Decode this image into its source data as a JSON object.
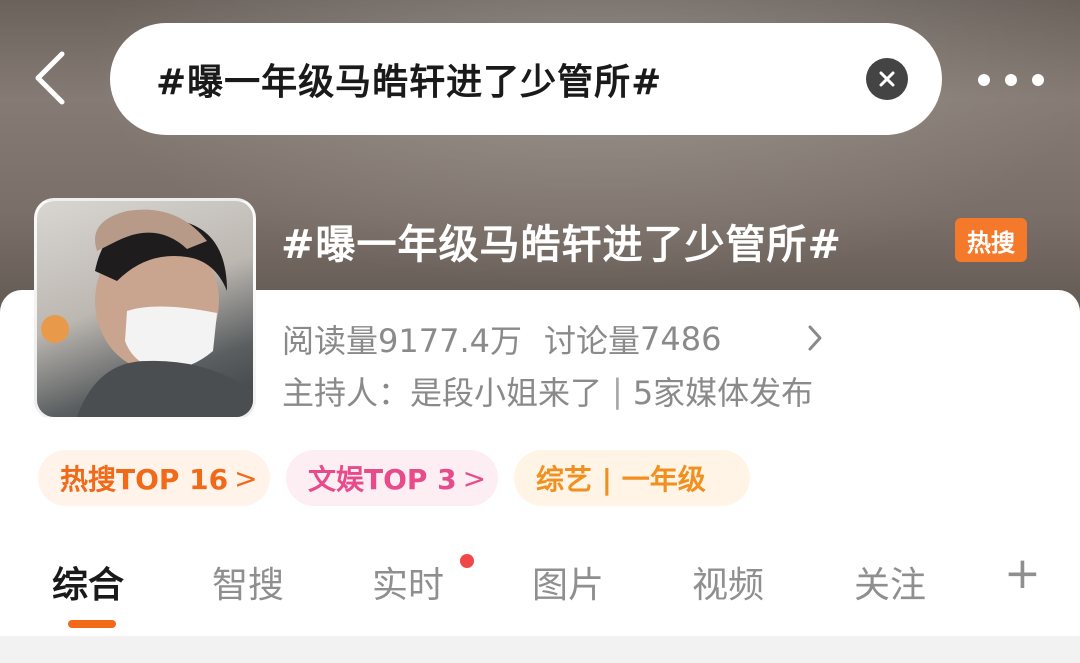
{
  "status_fragment": "",
  "search": {
    "query": "#曝一年级马皓轩进了少管所#"
  },
  "topic": {
    "title": "#曝一年级马皓轩进了少管所#",
    "badge": "热搜",
    "reads_label": "阅读量",
    "reads_value": "9177.4万",
    "discussions_label": "讨论量",
    "discussions_value": "7486",
    "host_label": "主持人：",
    "host_name": "是段小姐来了",
    "separator": "|",
    "media_count": "5家媒体发布"
  },
  "chips": [
    {
      "label": "热搜TOP 16",
      "arrow": ">"
    },
    {
      "label": "文娱TOP 3",
      "arrow": ">"
    },
    {
      "label": "综艺 | 一年级"
    }
  ],
  "tabs": [
    {
      "label": "综合",
      "active": true
    },
    {
      "label": "智搜"
    },
    {
      "label": "实时",
      "has_dot": true
    },
    {
      "label": "图片"
    },
    {
      "label": "视频"
    },
    {
      "label": "关注"
    },
    {
      "label": "+"
    }
  ],
  "colors": {
    "accent": "#f06a1a",
    "hot_badge": "#f5792b",
    "pink_chip_text": "#e84b8a",
    "red_dot": "#f04848"
  },
  "icons": {
    "back": "chevron-left-icon",
    "clear": "close-circle-icon",
    "more": "more-dots-icon",
    "stats_arrow": "chevron-right-icon"
  }
}
